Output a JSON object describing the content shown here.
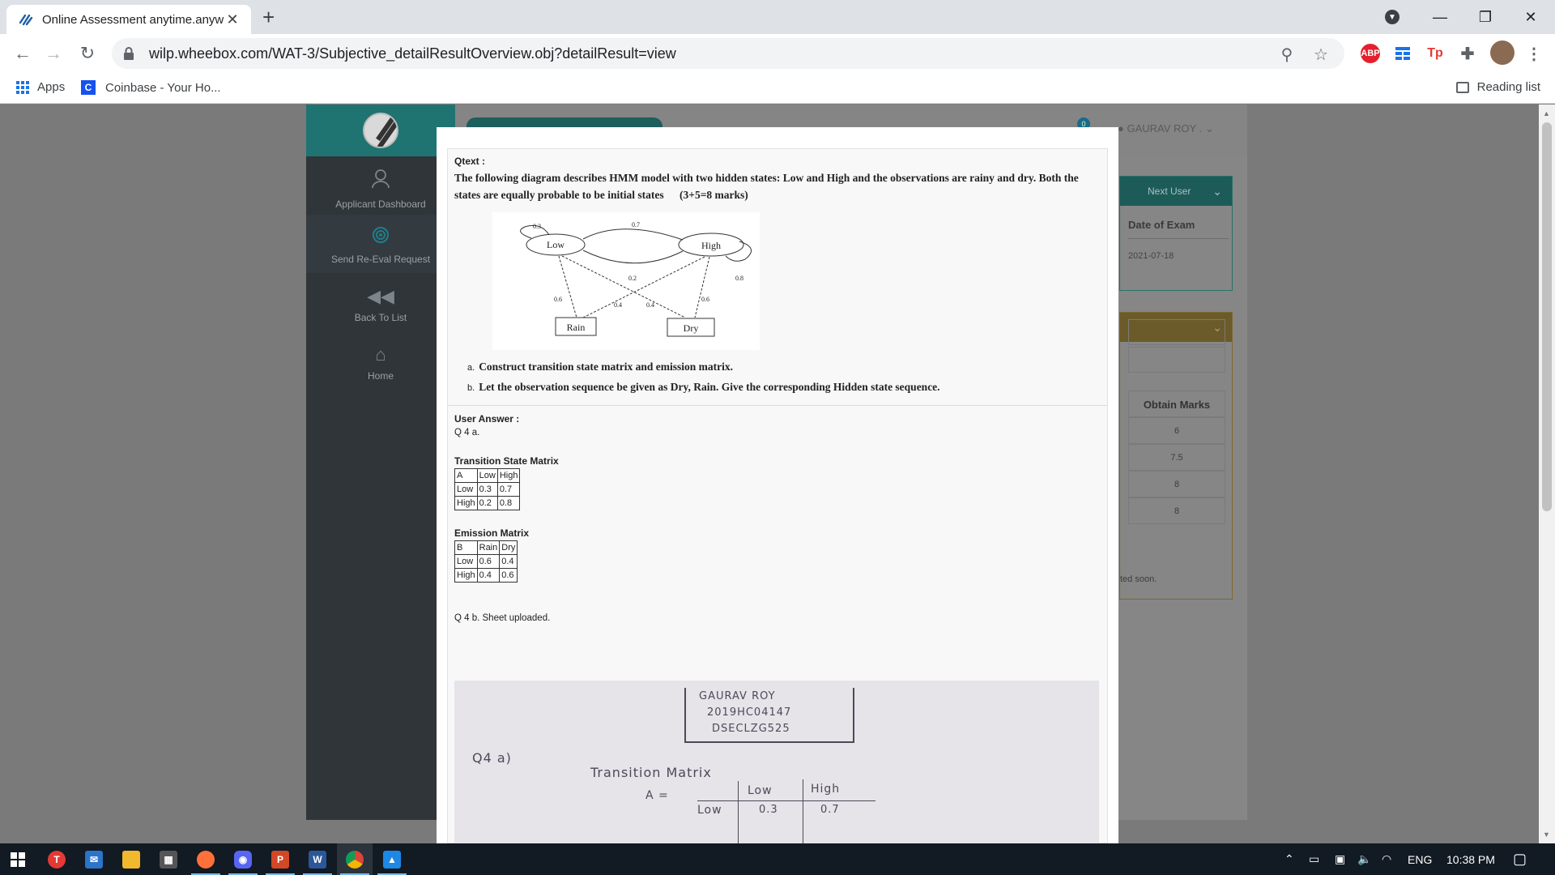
{
  "browser": {
    "tab_title": "Online Assessment anytime.anyw",
    "url": "wilp.wheebox.com/WAT-3/Subjective_detailResultOverview.obj?detailResult=view",
    "bookmarks": [
      {
        "label": "Apps"
      },
      {
        "label": "Coinbase - Your Ho..."
      }
    ],
    "reading_list": "Reading list",
    "extensions": {
      "abp": "ABP",
      "tp": "Tp"
    }
  },
  "sidebar": {
    "items": [
      {
        "label": "Applicant Dashboard"
      },
      {
        "label": "Send Re-Eval Request"
      },
      {
        "label": "Back To List"
      },
      {
        "label": "Home"
      }
    ]
  },
  "header": {
    "notification_count": "0",
    "user_name": "GAURAV ROY ."
  },
  "right_panel": {
    "nav_label": "Next User",
    "date_label": "Date of Exam",
    "date_value": "2021-07-18",
    "marks_header": "Obtain Marks",
    "marks": [
      "6",
      "7.5",
      "8",
      "8"
    ],
    "note": "ted soon."
  },
  "modal": {
    "qtext_label": "Qtext :",
    "question": "The following diagram describes HMM model with two hidden states: Low and High and the observations are rainy and dry. Both the states are equally probable to be initial states",
    "marks": "(3+5=8 marks)",
    "diagram": {
      "states": [
        "Low",
        "High"
      ],
      "observations": [
        "Rain",
        "Dry"
      ],
      "labels": {
        "low_self": "0.3",
        "low_high": "0.7",
        "high_low": "0.2",
        "high_self": "0.8",
        "low_rain": "0.6",
        "low_dry": "0.4",
        "high_rain": "0.4",
        "high_dry": "0.6"
      }
    },
    "sub_questions": [
      {
        "label": "a.",
        "text": "Construct transition state matrix and emission matrix."
      },
      {
        "label": "b.",
        "text": "Let the observation sequence be given as Dry, Rain. Give the corresponding Hidden state sequence."
      }
    ],
    "user_answer_label": "User Answer :",
    "q4a": "Q 4 a.",
    "transition_title": "Transition State Matrix",
    "transition_table": [
      [
        "A",
        "Low",
        "High"
      ],
      [
        "Low",
        "0.3",
        "0.7"
      ],
      [
        "High",
        "0.2",
        "0.8"
      ]
    ],
    "emission_title": "Emission Matrix",
    "emission_table": [
      [
        "B",
        "Rain",
        "Dry"
      ],
      [
        "Low",
        "0.6",
        "0.4"
      ],
      [
        "High",
        "0.4",
        "0.6"
      ]
    ],
    "q4b": "Q 4 b. Sheet uploaded.",
    "sheet": {
      "name": "GAURAV   ROY",
      "id": "2019HC04147",
      "course": "DSECLZG525",
      "q_label": "Q4   a)",
      "heading": "Transition Matrix",
      "a_label": "A =",
      "col1": "Low",
      "col2": "High",
      "row1": "Low",
      "v1": "0.3",
      "v2": "0.7"
    }
  },
  "taskbar": {
    "lang": "ENG",
    "time": "10:38 PM"
  }
}
